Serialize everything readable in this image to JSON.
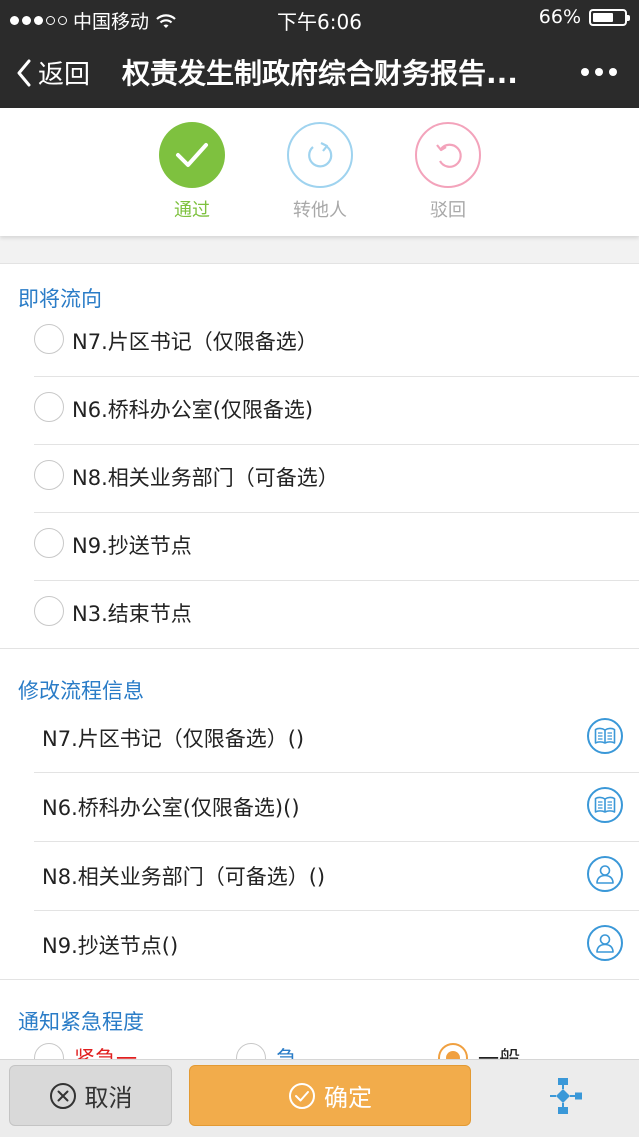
{
  "status_bar": {
    "carrier": "中国移动",
    "time": "下午6:06",
    "battery": "66%",
    "battery_level": 0.66
  },
  "nav": {
    "back_label": "返回",
    "title": "权责发生制政府综合财务报告..."
  },
  "actions": [
    {
      "label": "通过",
      "icon": "check-icon",
      "color": "#7ec13f",
      "selected": true
    },
    {
      "label": "转他人",
      "icon": "rotate-icon",
      "color": "#9fd3ef",
      "selected": false
    },
    {
      "label": "驳回",
      "icon": "undo-circle-icon",
      "color": "#f3a3bb",
      "selected": false
    }
  ],
  "next_flow": {
    "title": "即将流向",
    "options": [
      {
        "label": "N7.片区书记（仅限备选）",
        "checked": false
      },
      {
        "label": "N6.桥科办公室(仅限备选)",
        "checked": false
      },
      {
        "label": "N8.相关业务部门（可备选）",
        "checked": false
      },
      {
        "label": "N9.抄送节点",
        "checked": false
      },
      {
        "label": "N3.结束节点",
        "checked": false
      }
    ]
  },
  "modify_flow": {
    "title": "修改流程信息",
    "items": [
      {
        "label": "N7.片区书记（仅限备选）()",
        "icon": "book-icon"
      },
      {
        "label": "N6.桥科办公室(仅限备选)()",
        "icon": "book-icon"
      },
      {
        "label": "N8.相关业务部门（可备选）()",
        "icon": "user-icon"
      },
      {
        "label": "N9.抄送节点()",
        "icon": "user-icon"
      }
    ]
  },
  "urgency": {
    "title": "通知紧急程度",
    "options": [
      {
        "label": "紧急一",
        "color": "#e02020",
        "selected": false
      },
      {
        "label": "急",
        "color": "#2a7cc7",
        "selected": false
      },
      {
        "label": "一般",
        "color": "#222222",
        "selected": true
      }
    ]
  },
  "toolbar": {
    "cancel_label": "取消",
    "confirm_label": "确定",
    "flow_icon": "flowchart-icon"
  },
  "colors": {
    "accent_blue": "#2a7cc7",
    "approve_green": "#7ec13f",
    "confirm_orange": "#f2ac4b",
    "dark_bar": "#2b2b2b"
  }
}
